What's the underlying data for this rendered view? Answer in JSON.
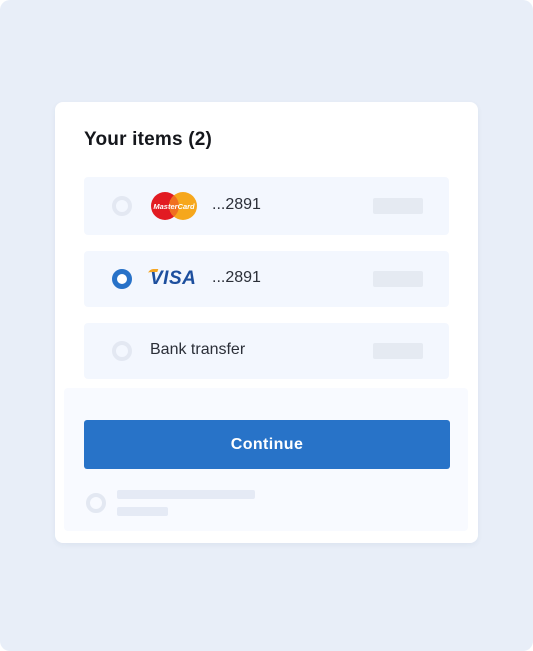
{
  "card": {
    "title": "Your items (2)"
  },
  "payment_options": [
    {
      "method": "mastercard",
      "logo_text": "MasterCard",
      "masked_number": "...2891",
      "selected": false
    },
    {
      "method": "visa",
      "logo_text": "VISA",
      "masked_number": "...2891",
      "selected": true
    },
    {
      "method": "bank-transfer",
      "label": "Bank transfer",
      "selected": false
    }
  ],
  "actions": {
    "continue_label": "Continue"
  },
  "colors": {
    "background": "#e8eef8",
    "option_bg": "#f3f7fe",
    "accent": "#2873c8",
    "placeholder": "#e5eaf2"
  }
}
